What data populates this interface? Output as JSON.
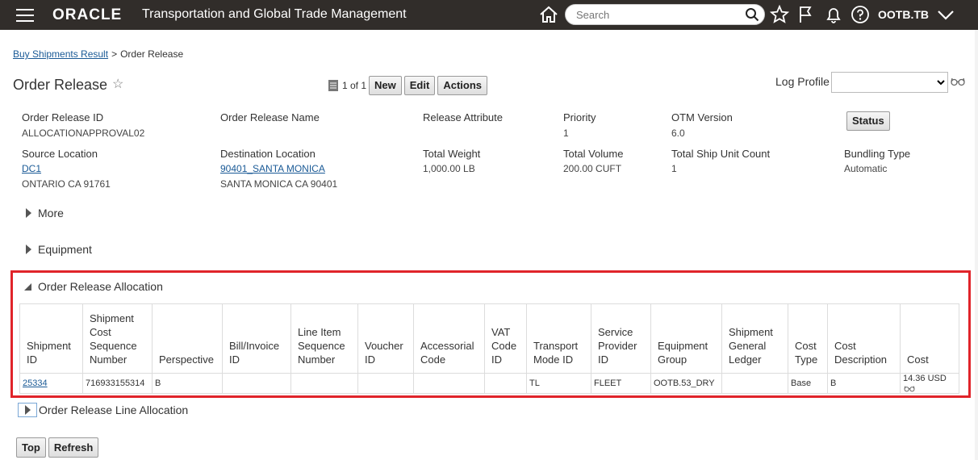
{
  "header": {
    "logo": "ORACLE",
    "app_title": "Transportation and Global Trade Management",
    "search_placeholder": "Search",
    "user": "OOTB.TB"
  },
  "breadcrumb": {
    "parent": "Buy Shipments Result",
    "separator": ">",
    "current": "Order Release"
  },
  "page": {
    "title": "Order Release",
    "pager_text": "1 of 1",
    "buttons": {
      "new": "New",
      "edit": "Edit",
      "actions": "Actions"
    },
    "log_profile_label": "Log Profile",
    "log_profile_value": ""
  },
  "summary": {
    "order_release_id_label": "Order Release ID",
    "order_release_id": "ALLOCATIONAPPROVAL02",
    "order_release_name_label": "Order Release Name",
    "release_attribute_label": "Release Attribute",
    "priority_label": "Priority",
    "priority": "1",
    "otm_version_label": "OTM Version",
    "otm_version": "6.0",
    "status_button": "Status",
    "source_location_label": "Source Location",
    "source_location_link": "DC1",
    "source_location_addr": "ONTARIO CA 91761",
    "destination_location_label": "Destination Location",
    "destination_location_link": "90401_SANTA MONICA",
    "destination_location_addr": "SANTA MONICA CA 90401",
    "total_weight_label": "Total Weight",
    "total_weight": "1,000.00 LB",
    "total_volume_label": "Total Volume",
    "total_volume": "200.00 CUFT",
    "total_ship_unit_count_label": "Total Ship Unit Count",
    "total_ship_unit_count": "1",
    "bundling_type_label": "Bundling Type",
    "bundling_type": "Automatic"
  },
  "sections": {
    "more": "More",
    "equipment": "Equipment",
    "allocation": "Order Release Allocation",
    "line_allocation": "Order Release Line Allocation"
  },
  "allocation_table": {
    "headers": [
      "Shipment ID",
      "Shipment Cost Sequence Number",
      "Perspective",
      "Bill/Invoice ID",
      "Line Item Sequence Number",
      "Voucher ID",
      "Accessorial Code",
      "VAT Code ID",
      "Transport Mode ID",
      "Service Provider ID",
      "Equipment Group",
      "Shipment General Ledger",
      "Cost Type",
      "Cost Description",
      "Cost"
    ],
    "rows": [
      [
        "25334",
        "716933155314",
        "B",
        "",
        "",
        "",
        "",
        "",
        "TL",
        "FLEET",
        "OOTB.53_DRY",
        "",
        "Base",
        "B",
        "14.36 USD"
      ]
    ]
  },
  "footer_buttons": {
    "top": "Top",
    "refresh": "Refresh"
  }
}
